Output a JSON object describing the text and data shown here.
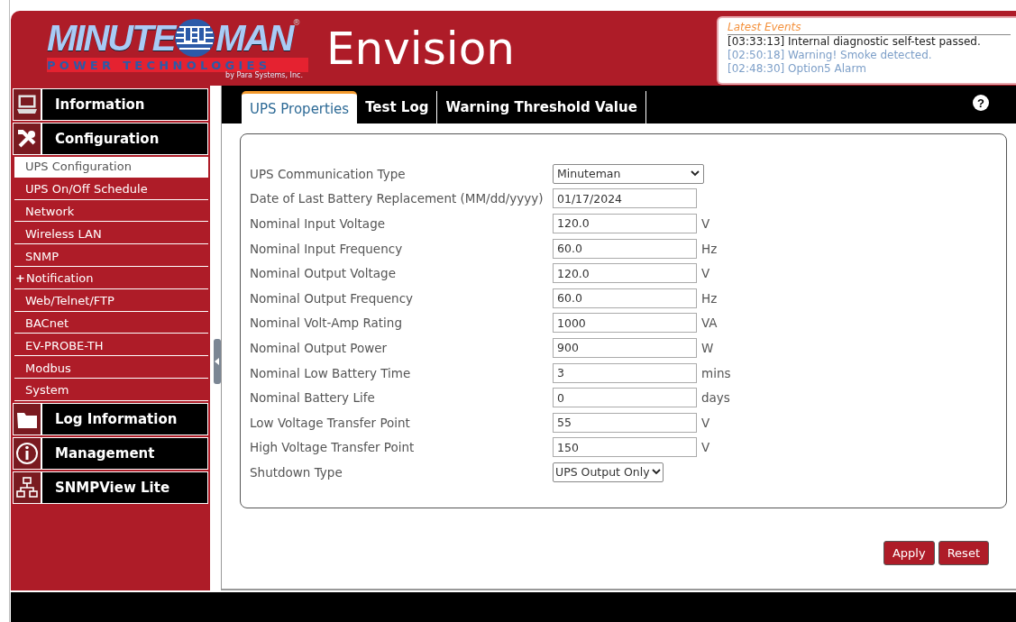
{
  "header": {
    "logo": {
      "word_left": "MINUTE",
      "word_right": "MAN",
      "registered": "®",
      "tagline": "POWER TECHNOLOGIES",
      "byline": "by Para Systems, Inc."
    },
    "product": "Envision"
  },
  "latest_events": {
    "title": "Latest Events",
    "events": [
      {
        "text": "[03:33:13] Internal diagnostic self-test passed.",
        "read": false
      },
      {
        "text": "[02:50:18] Warning! Smoke detected.",
        "read": true
      },
      {
        "text": "[02:48:30] Option5 Alarm",
        "read": true
      }
    ]
  },
  "sidebar": {
    "sections": [
      {
        "label": "Information"
      },
      {
        "label": "Configuration",
        "children": [
          {
            "label": "UPS Configuration",
            "selected": true
          },
          {
            "label": "UPS On/Off Schedule",
            "selected": false
          },
          {
            "label": "Network",
            "selected": false
          },
          {
            "label": "Wireless LAN",
            "selected": false
          },
          {
            "label": "SNMP",
            "selected": false
          },
          {
            "prefix": "+",
            "label": "Notification",
            "selected": false
          },
          {
            "label": "Web/Telnet/FTP",
            "selected": false
          },
          {
            "label": "BACnet",
            "selected": false
          },
          {
            "label": "EV-PROBE-TH",
            "selected": false
          },
          {
            "label": "Modbus",
            "selected": false
          },
          {
            "label": "System",
            "selected": false
          }
        ]
      },
      {
        "label": "Log Information"
      },
      {
        "label": "Management"
      },
      {
        "label": "SNMPView Lite"
      }
    ]
  },
  "tabs": [
    {
      "label": "UPS Properties",
      "selected": true
    },
    {
      "label": "Test Log",
      "selected": false
    },
    {
      "label": "Warning Threshold Value",
      "selected": false
    }
  ],
  "help": "?",
  "form": {
    "rows": [
      {
        "kind": "select",
        "label": "UPS Communication Type",
        "value": "Minuteman"
      },
      {
        "kind": "input",
        "label": "Date of Last Battery Replacement (MM/dd/yyyy)",
        "value": "01/17/2024"
      },
      {
        "kind": "input",
        "label": "Nominal Input Voltage",
        "value": "120.0",
        "unit": "V"
      },
      {
        "kind": "input",
        "label": "Nominal Input Frequency",
        "value": "60.0",
        "unit": "Hz"
      },
      {
        "kind": "input",
        "label": "Nominal Output Voltage",
        "value": "120.0",
        "unit": "V"
      },
      {
        "kind": "input",
        "label": "Nominal Output Frequency",
        "value": "60.0",
        "unit": "Hz"
      },
      {
        "kind": "input",
        "label": "Nominal Volt-Amp Rating",
        "value": "1000",
        "unit": "VA"
      },
      {
        "kind": "input",
        "label": "Nominal Output Power",
        "value": "900",
        "unit": "W"
      },
      {
        "kind": "input",
        "label": "Nominal Low Battery Time",
        "value": "3",
        "unit": "mins"
      },
      {
        "kind": "input",
        "label": "Nominal Battery Life",
        "value": "0",
        "unit": "days"
      },
      {
        "kind": "input",
        "label": "Low Voltage Transfer Point",
        "value": "55",
        "unit": "V"
      },
      {
        "kind": "input",
        "label": "High Voltage Transfer Point",
        "value": "150",
        "unit": "V"
      },
      {
        "kind": "small-select",
        "label": "Shutdown Type",
        "value": "UPS Output Only"
      }
    ]
  },
  "buttons": [
    "Apply",
    "Reset"
  ]
}
